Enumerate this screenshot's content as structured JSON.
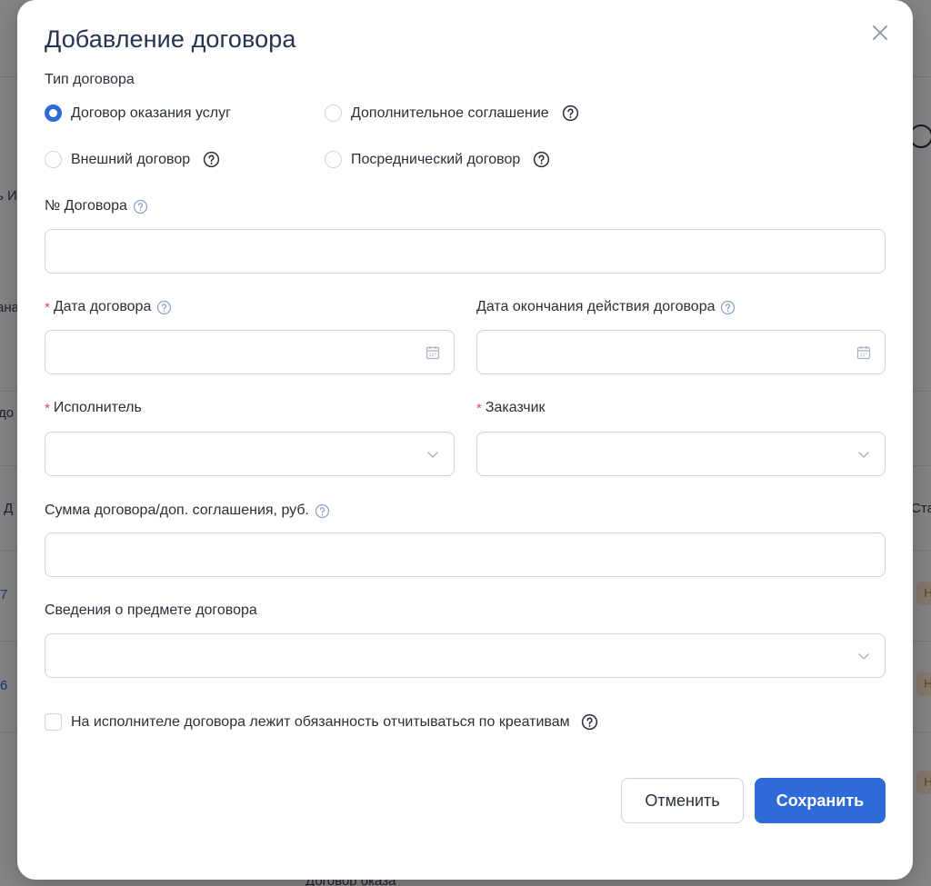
{
  "background": {
    "fragments": [
      "ь И",
      "ана",
      "до",
      "° Д",
      "7",
      "6",
      "Ста",
      "Договор оказа"
    ],
    "status_badge": "Н"
  },
  "modal": {
    "title": "Добавление договора",
    "contract_type": {
      "label": "Тип договора",
      "options": [
        {
          "label": "Договор оказания услуг",
          "checked": true
        },
        {
          "label": "Дополнительное соглашение",
          "checked": false
        },
        {
          "label": "Внешний договор",
          "checked": false
        },
        {
          "label": "Посреднический договор",
          "checked": false
        }
      ]
    },
    "contract_number": {
      "label": "№ Договора",
      "value": ""
    },
    "contract_date": {
      "label": "Дата договора",
      "required": "*",
      "value": ""
    },
    "contract_end_date": {
      "label": "Дата окончания действия договора",
      "value": ""
    },
    "executor": {
      "label": "Исполнитель",
      "required": "*",
      "value": ""
    },
    "customer": {
      "label": "Заказчик",
      "required": "*",
      "value": ""
    },
    "amount": {
      "label": "Сумма договора/доп. соглашения, руб.",
      "value": ""
    },
    "subject": {
      "label": "Сведения о предмете договора",
      "value": ""
    },
    "creatives_checkbox": {
      "label": "На исполнителе договора лежит обязанность отчитываться по креативам",
      "checked": false
    },
    "buttons": {
      "cancel": "Отменить",
      "save": "Сохранить"
    }
  },
  "colors": {
    "accent": "#2f6bd8",
    "required": "#e5484d",
    "border": "#c9d3e6",
    "title": "#26344f"
  }
}
